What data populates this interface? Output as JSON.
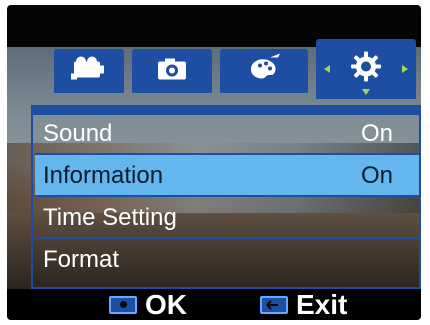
{
  "tabs": [
    {
      "name": "video-mode-tab",
      "icon": "video-camera-icon"
    },
    {
      "name": "photo-mode-tab",
      "icon": "camera-icon"
    },
    {
      "name": "effects-mode-tab",
      "icon": "palette-icon"
    },
    {
      "name": "settings-mode-tab",
      "icon": "gear-icon",
      "active": true
    }
  ],
  "menu": {
    "items": [
      {
        "label": "Sound",
        "value": "On"
      },
      {
        "label": "Information",
        "value": "On",
        "selected": true
      },
      {
        "label": "Time Setting",
        "value": ""
      },
      {
        "label": "Format",
        "value": ""
      }
    ]
  },
  "footer": {
    "ok_label": "OK",
    "exit_label": "Exit"
  },
  "colors": {
    "tab_blue": "#1e4ea3",
    "highlight": "#63b7ee",
    "arrow_green": "#a6d64c"
  }
}
